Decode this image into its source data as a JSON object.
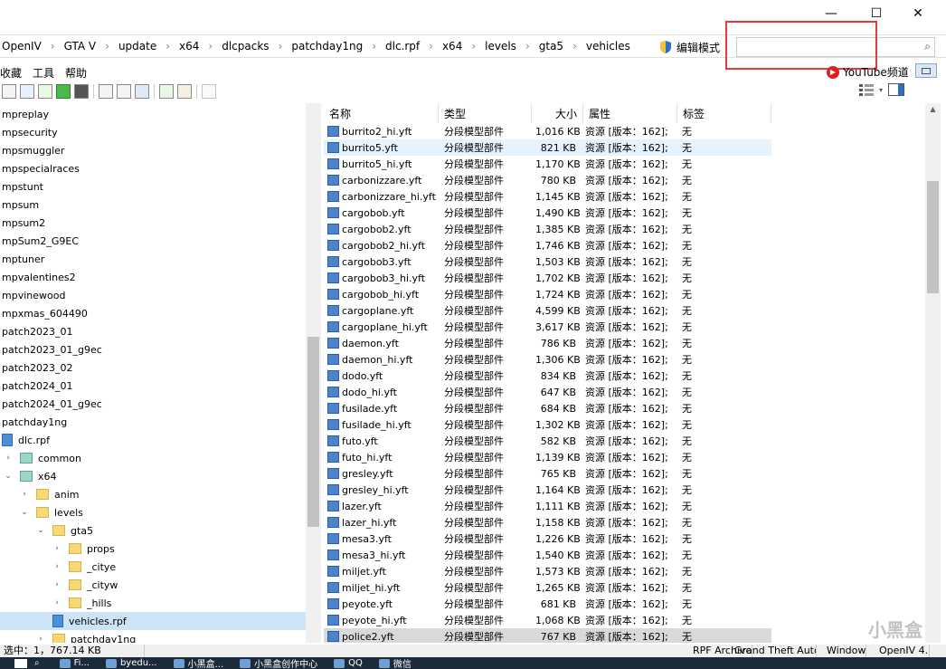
{
  "titlebar": {
    "minimize": "—",
    "maximize": "☐",
    "close": "✕"
  },
  "address": {
    "crumbs": [
      "OpenIV",
      "GTA V",
      "update",
      "x64",
      "dlcpacks",
      "patchday1ng",
      "dlc.rpf",
      "x64",
      "levels",
      "gta5",
      "vehicles"
    ],
    "edit_mode": "编辑模式",
    "search_value": "",
    "search_icon": "search-icon"
  },
  "menubar": {
    "items": [
      "收藏",
      "工具",
      "帮助"
    ],
    "youtube": "YouTube频道"
  },
  "tree": {
    "items": [
      {
        "label": "mpreplay",
        "indent": 0,
        "icon": "none"
      },
      {
        "label": "mpsecurity",
        "indent": 0,
        "icon": "none"
      },
      {
        "label": "mpsmuggler",
        "indent": 0,
        "icon": "none"
      },
      {
        "label": "mpspecialraces",
        "indent": 0,
        "icon": "none"
      },
      {
        "label": "mpstunt",
        "indent": 0,
        "icon": "none"
      },
      {
        "label": "mpsum",
        "indent": 0,
        "icon": "none"
      },
      {
        "label": "mpsum2",
        "indent": 0,
        "icon": "none"
      },
      {
        "label": "mpSum2_G9EC",
        "indent": 0,
        "icon": "none"
      },
      {
        "label": "mptuner",
        "indent": 0,
        "icon": "none"
      },
      {
        "label": "mpvalentines2",
        "indent": 0,
        "icon": "none"
      },
      {
        "label": "mpvinewood",
        "indent": 0,
        "icon": "none"
      },
      {
        "label": "mpxmas_604490",
        "indent": 0,
        "icon": "none"
      },
      {
        "label": "patch2023_01",
        "indent": 0,
        "icon": "none"
      },
      {
        "label": "patch2023_01_g9ec",
        "indent": 0,
        "icon": "none"
      },
      {
        "label": "patch2023_02",
        "indent": 0,
        "icon": "none"
      },
      {
        "label": "patch2024_01",
        "indent": 0,
        "icon": "none"
      },
      {
        "label": "patch2024_01_g9ec",
        "indent": 0,
        "icon": "none"
      },
      {
        "label": "patchday1ng",
        "indent": 0,
        "icon": "none"
      },
      {
        "label": "dlc.rpf",
        "indent": 0,
        "icon": "rpf"
      },
      {
        "label": "common",
        "indent": 1,
        "icon": "teal",
        "twisty": "›"
      },
      {
        "label": "x64",
        "indent": 1,
        "icon": "teal",
        "twisty": "⌄"
      },
      {
        "label": "anim",
        "indent": 2,
        "icon": "folder",
        "twisty": "›"
      },
      {
        "label": "levels",
        "indent": 2,
        "icon": "folder",
        "twisty": "⌄"
      },
      {
        "label": "gta5",
        "indent": 3,
        "icon": "folder",
        "twisty": "⌄"
      },
      {
        "label": "props",
        "indent": 4,
        "icon": "folder",
        "twisty": "›"
      },
      {
        "label": "_citye",
        "indent": 4,
        "icon": "folder",
        "twisty": "›"
      },
      {
        "label": "_cityw",
        "indent": 4,
        "icon": "folder",
        "twisty": "›"
      },
      {
        "label": "_hills",
        "indent": 4,
        "icon": "folder",
        "twisty": "›"
      },
      {
        "label": "vehicles.rpf",
        "indent": 4,
        "icon": "rpf",
        "selected": true
      },
      {
        "label": "patchday1ng",
        "indent": 3,
        "icon": "folder",
        "twisty": "›"
      }
    ]
  },
  "list": {
    "columns": [
      "名称",
      "类型",
      "大小",
      "属性",
      "标签"
    ],
    "rows": [
      {
        "name": "burrito2_hi.yft",
        "type": "分段模型部件",
        "size": "1,016 KB",
        "attr": "资源 [版本：162];",
        "tag": "无"
      },
      {
        "name": "burrito5.yft",
        "type": "分段模型部件",
        "size": "821 KB",
        "attr": "资源 [版本：162];",
        "tag": "无",
        "hover": true
      },
      {
        "name": "burrito5_hi.yft",
        "type": "分段模型部件",
        "size": "1,170 KB",
        "attr": "资源 [版本：162];",
        "tag": "无"
      },
      {
        "name": "carbonizzare.yft",
        "type": "分段模型部件",
        "size": "780 KB",
        "attr": "资源 [版本：162];",
        "tag": "无"
      },
      {
        "name": "carbonizzare_hi.yft",
        "type": "分段模型部件",
        "size": "1,145 KB",
        "attr": "资源 [版本：162];",
        "tag": "无"
      },
      {
        "name": "cargobob.yft",
        "type": "分段模型部件",
        "size": "1,490 KB",
        "attr": "资源 [版本：162];",
        "tag": "无"
      },
      {
        "name": "cargobob2.yft",
        "type": "分段模型部件",
        "size": "1,385 KB",
        "attr": "资源 [版本：162];",
        "tag": "无"
      },
      {
        "name": "cargobob2_hi.yft",
        "type": "分段模型部件",
        "size": "1,746 KB",
        "attr": "资源 [版本：162];",
        "tag": "无"
      },
      {
        "name": "cargobob3.yft",
        "type": "分段模型部件",
        "size": "1,503 KB",
        "attr": "资源 [版本：162];",
        "tag": "无"
      },
      {
        "name": "cargobob3_hi.yft",
        "type": "分段模型部件",
        "size": "1,702 KB",
        "attr": "资源 [版本：162];",
        "tag": "无"
      },
      {
        "name": "cargobob_hi.yft",
        "type": "分段模型部件",
        "size": "1,724 KB",
        "attr": "资源 [版本：162];",
        "tag": "无"
      },
      {
        "name": "cargoplane.yft",
        "type": "分段模型部件",
        "size": "4,599 KB",
        "attr": "资源 [版本：162];",
        "tag": "无"
      },
      {
        "name": "cargoplane_hi.yft",
        "type": "分段模型部件",
        "size": "3,617 KB",
        "attr": "资源 [版本：162];",
        "tag": "无"
      },
      {
        "name": "daemon.yft",
        "type": "分段模型部件",
        "size": "786 KB",
        "attr": "资源 [版本：162];",
        "tag": "无"
      },
      {
        "name": "daemon_hi.yft",
        "type": "分段模型部件",
        "size": "1,306 KB",
        "attr": "资源 [版本：162];",
        "tag": "无"
      },
      {
        "name": "dodo.yft",
        "type": "分段模型部件",
        "size": "834 KB",
        "attr": "资源 [版本：162];",
        "tag": "无"
      },
      {
        "name": "dodo_hi.yft",
        "type": "分段模型部件",
        "size": "647 KB",
        "attr": "资源 [版本：162];",
        "tag": "无"
      },
      {
        "name": "fusilade.yft",
        "type": "分段模型部件",
        "size": "684 KB",
        "attr": "资源 [版本：162];",
        "tag": "无"
      },
      {
        "name": "fusilade_hi.yft",
        "type": "分段模型部件",
        "size": "1,302 KB",
        "attr": "资源 [版本：162];",
        "tag": "无"
      },
      {
        "name": "futo.yft",
        "type": "分段模型部件",
        "size": "582 KB",
        "attr": "资源 [版本：162];",
        "tag": "无"
      },
      {
        "name": "futo_hi.yft",
        "type": "分段模型部件",
        "size": "1,139 KB",
        "attr": "资源 [版本：162];",
        "tag": "无"
      },
      {
        "name": "gresley.yft",
        "type": "分段模型部件",
        "size": "765 KB",
        "attr": "资源 [版本：162];",
        "tag": "无"
      },
      {
        "name": "gresley_hi.yft",
        "type": "分段模型部件",
        "size": "1,164 KB",
        "attr": "资源 [版本：162];",
        "tag": "无"
      },
      {
        "name": "lazer.yft",
        "type": "分段模型部件",
        "size": "1,111 KB",
        "attr": "资源 [版本：162];",
        "tag": "无"
      },
      {
        "name": "lazer_hi.yft",
        "type": "分段模型部件",
        "size": "1,158 KB",
        "attr": "资源 [版本：162];",
        "tag": "无"
      },
      {
        "name": "mesa3.yft",
        "type": "分段模型部件",
        "size": "1,226 KB",
        "attr": "资源 [版本：162];",
        "tag": "无"
      },
      {
        "name": "mesa3_hi.yft",
        "type": "分段模型部件",
        "size": "1,540 KB",
        "attr": "资源 [版本：162];",
        "tag": "无"
      },
      {
        "name": "miljet.yft",
        "type": "分段模型部件",
        "size": "1,573 KB",
        "attr": "资源 [版本：162];",
        "tag": "无"
      },
      {
        "name": "miljet_hi.yft",
        "type": "分段模型部件",
        "size": "1,265 KB",
        "attr": "资源 [版本：162];",
        "tag": "无"
      },
      {
        "name": "peyote.yft",
        "type": "分段模型部件",
        "size": "681 KB",
        "attr": "资源 [版本：162];",
        "tag": "无"
      },
      {
        "name": "peyote_hi.yft",
        "type": "分段模型部件",
        "size": "1,068 KB",
        "attr": "资源 [版本：162];",
        "tag": "无"
      },
      {
        "name": "police2.yft",
        "type": "分段模型部件",
        "size": "767 KB",
        "attr": "资源 [版本：162];",
        "tag": "无",
        "selected": true
      }
    ]
  },
  "statusbar": {
    "items": [
      "选中：1，767.14 KB",
      "RPF Archive",
      "Grand Theft Auto V",
      "Windows",
      "OpenIV 4.1"
    ]
  },
  "taskbar": {
    "items": [
      "Fi...",
      "byedu...",
      "小黑盒...",
      "小黑盒创作中心",
      "QQ",
      "微信"
    ]
  },
  "watermark": "小黑盒"
}
